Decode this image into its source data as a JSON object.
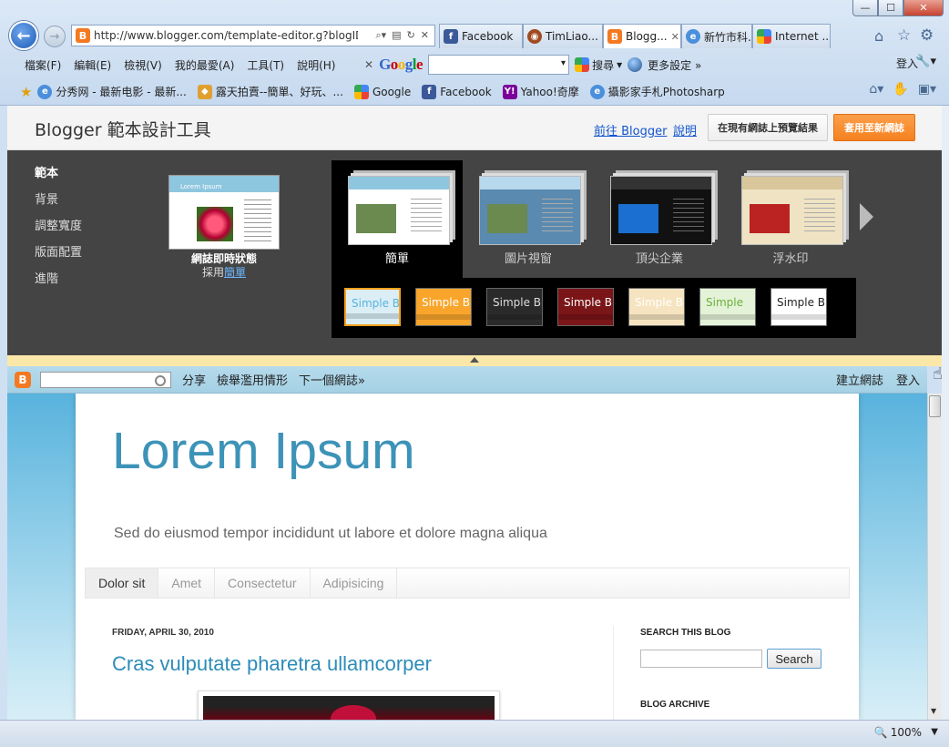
{
  "browser": {
    "window_controls": {
      "minimize": "—",
      "maximize": "☐",
      "close": "✕"
    },
    "address_url": "http://www.blogger.com/template-editor.g?blogID",
    "tabs": [
      {
        "label": "Facebook",
        "icon": "facebook-icon",
        "active": false
      },
      {
        "label": "TimLiao...",
        "icon": "timliao-icon",
        "active": false
      },
      {
        "label": "Blogg...",
        "icon": "blogger-icon",
        "active": true
      },
      {
        "label": "新竹市科...",
        "icon": "ie-page-icon",
        "active": false
      },
      {
        "label": "Internet ...",
        "icon": "google-icon",
        "active": false
      }
    ],
    "menus": [
      "檔案(F)",
      "編輯(E)",
      "檢視(V)",
      "我的最愛(A)",
      "工具(T)",
      "說明(H)"
    ],
    "google_toolbar": {
      "logo": "Google",
      "search_label": "搜尋",
      "more_settings": "更多設定 »",
      "login": "登入"
    },
    "favorites": [
      {
        "label": "分秀网 - 最新电影 - 最新...",
        "icon": "ie-page-icon"
      },
      {
        "label": "露天拍賣--簡單、好玩、...",
        "icon": "ruten-icon"
      },
      {
        "label": "Google",
        "icon": "google-icon"
      },
      {
        "label": "Facebook",
        "icon": "facebook-icon"
      },
      {
        "label": "Yahoo!奇摩",
        "icon": "yahoo-icon"
      },
      {
        "label": "攝影家手札Photosharp",
        "icon": "ie-page-icon"
      }
    ],
    "zoom": "100%"
  },
  "editor": {
    "title": "Blogger 範本設計工具",
    "link_blogger": "前往 Blogger",
    "link_help": "說明",
    "preview_button": "在現有網誌上預覽結果",
    "apply_button": "套用至新網誌",
    "side_nav": [
      "範本",
      "背景",
      "調整寬度",
      "版面配置",
      "進階"
    ],
    "live_caption": "網誌即時狀態",
    "live_use_prefix": "採用",
    "live_use_template": "簡單",
    "live_thumb_title": "Lorem Ipsum",
    "templates": [
      {
        "label": "簡單",
        "selected": true
      },
      {
        "label": "圖片視窗",
        "selected": false
      },
      {
        "label": "頂尖企業",
        "selected": false
      },
      {
        "label": "浮水印",
        "selected": false
      }
    ],
    "styles": [
      {
        "label": "Simple B",
        "selected": true
      },
      {
        "label": "Simple B",
        "selected": false
      },
      {
        "label": "Simple B",
        "selected": false
      },
      {
        "label": "Simple B",
        "selected": false
      },
      {
        "label": "Simple Blo",
        "selected": false
      },
      {
        "label": "Simple",
        "selected": false
      },
      {
        "label": "Simple Blo",
        "selected": false
      }
    ]
  },
  "blog_navbar": {
    "share": "分享",
    "report": "檢舉濫用情形",
    "next_blog": "下一個網誌»",
    "create_blog": "建立網誌",
    "login": "登入"
  },
  "blog": {
    "title": "Lorem Ipsum",
    "description": "Sed do eiusmod tempor incididunt ut labore et dolore magna aliqua",
    "tabs": [
      "Dolor sit",
      "Amet",
      "Consectetur",
      "Adipisicing"
    ],
    "post_date": "FRIDAY, APRIL 30, 2010",
    "post_title": "Cras vulputate pharetra ullamcorper",
    "search_heading": "SEARCH THIS BLOG",
    "search_button": "Search",
    "archive_heading": "BLOG ARCHIVE"
  },
  "colors": {
    "accent_orange": "#f5811f",
    "blog_title": "#3d93b7",
    "panel_dark": "#444444"
  }
}
